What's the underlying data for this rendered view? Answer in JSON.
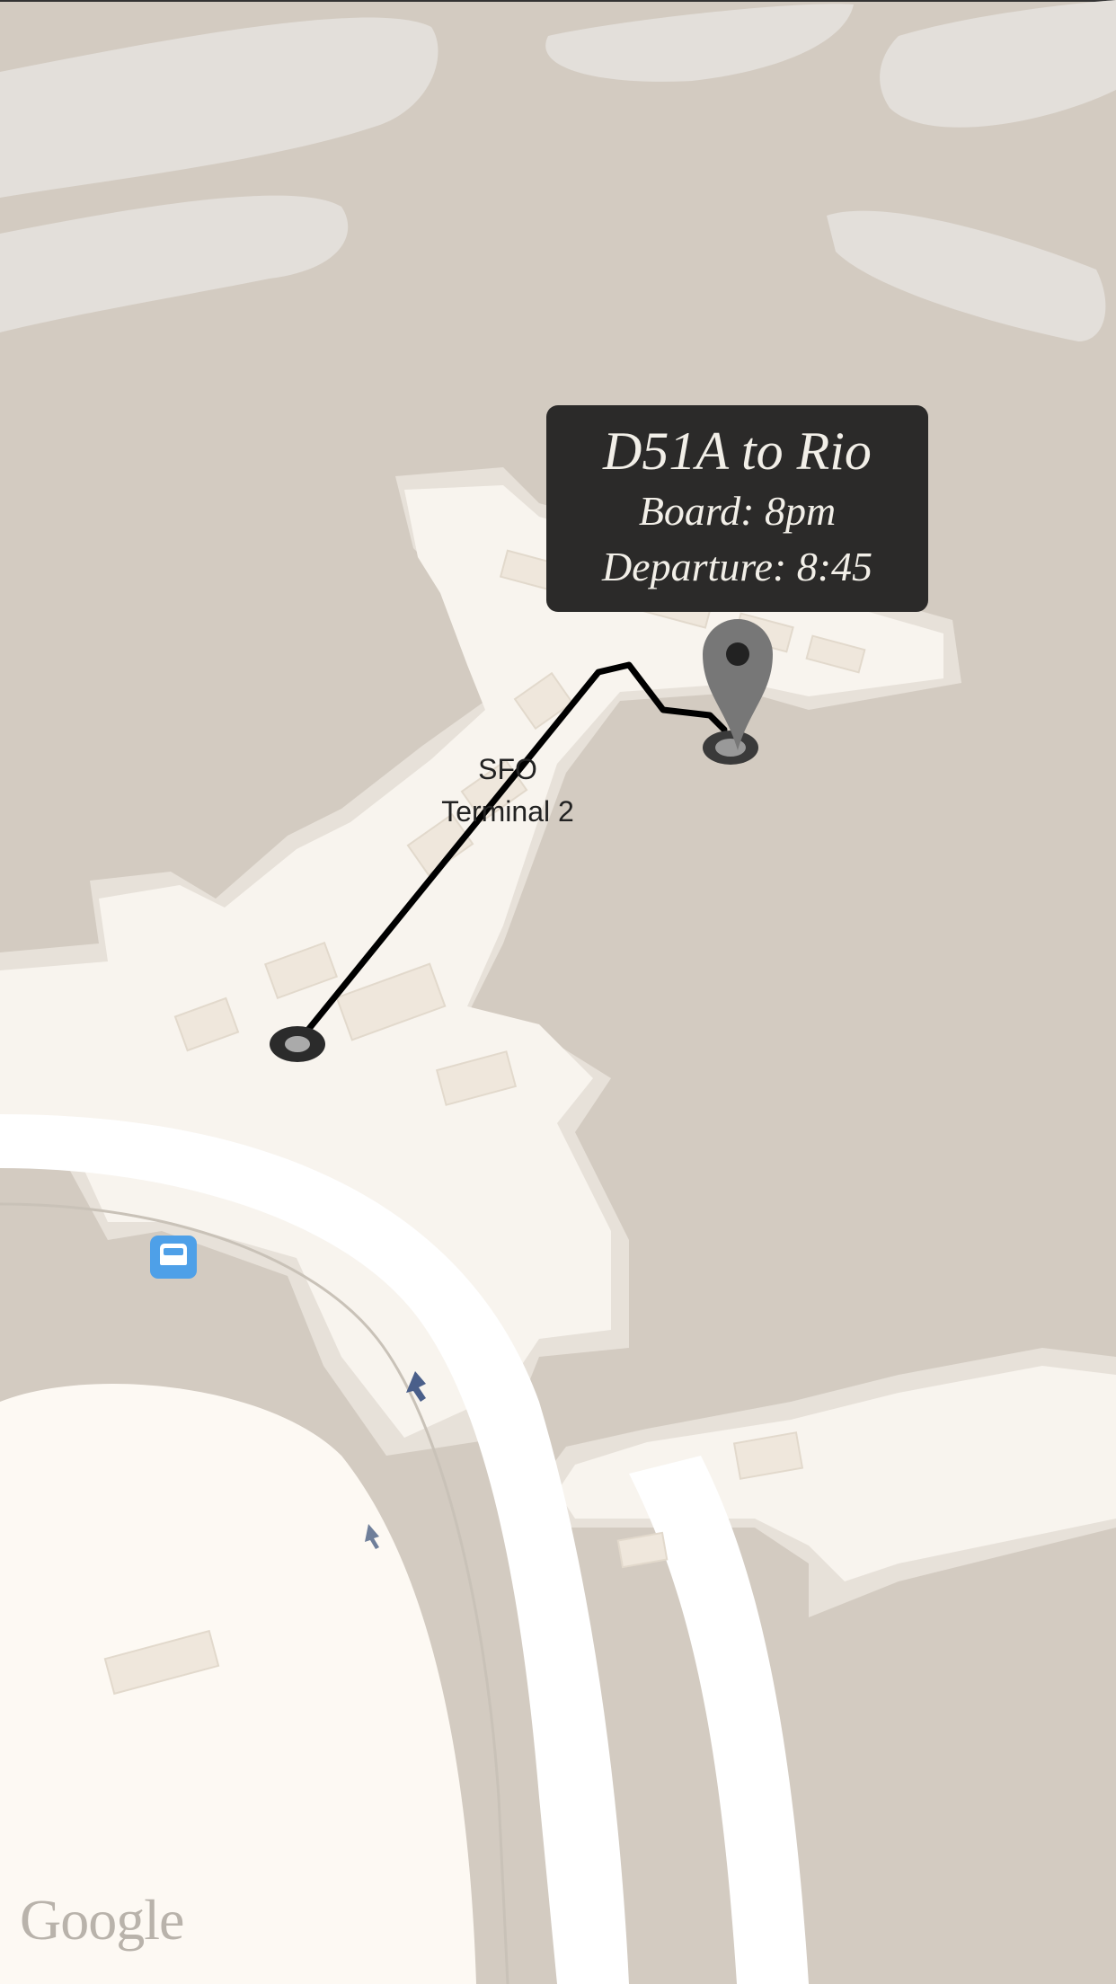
{
  "map": {
    "building_label_line1": "SFO",
    "building_label_line2": "Terminal 2",
    "attribution": "Google",
    "colors": {
      "ground": "#d3cbc1",
      "building": "#f8f4ee",
      "route": "#000000",
      "tooltip_bg": "#2b2a29",
      "transit": "#4ea0e8"
    }
  },
  "callout": {
    "title": "D51A to Rio",
    "boarding": "Board: 8pm",
    "departure": "Departure: 8:45"
  },
  "icons": {
    "destination_pin": "map-pin-icon",
    "origin_marker": "location-dot-icon",
    "transit": "bus-icon",
    "arrow": "direction-arrow-icon"
  }
}
